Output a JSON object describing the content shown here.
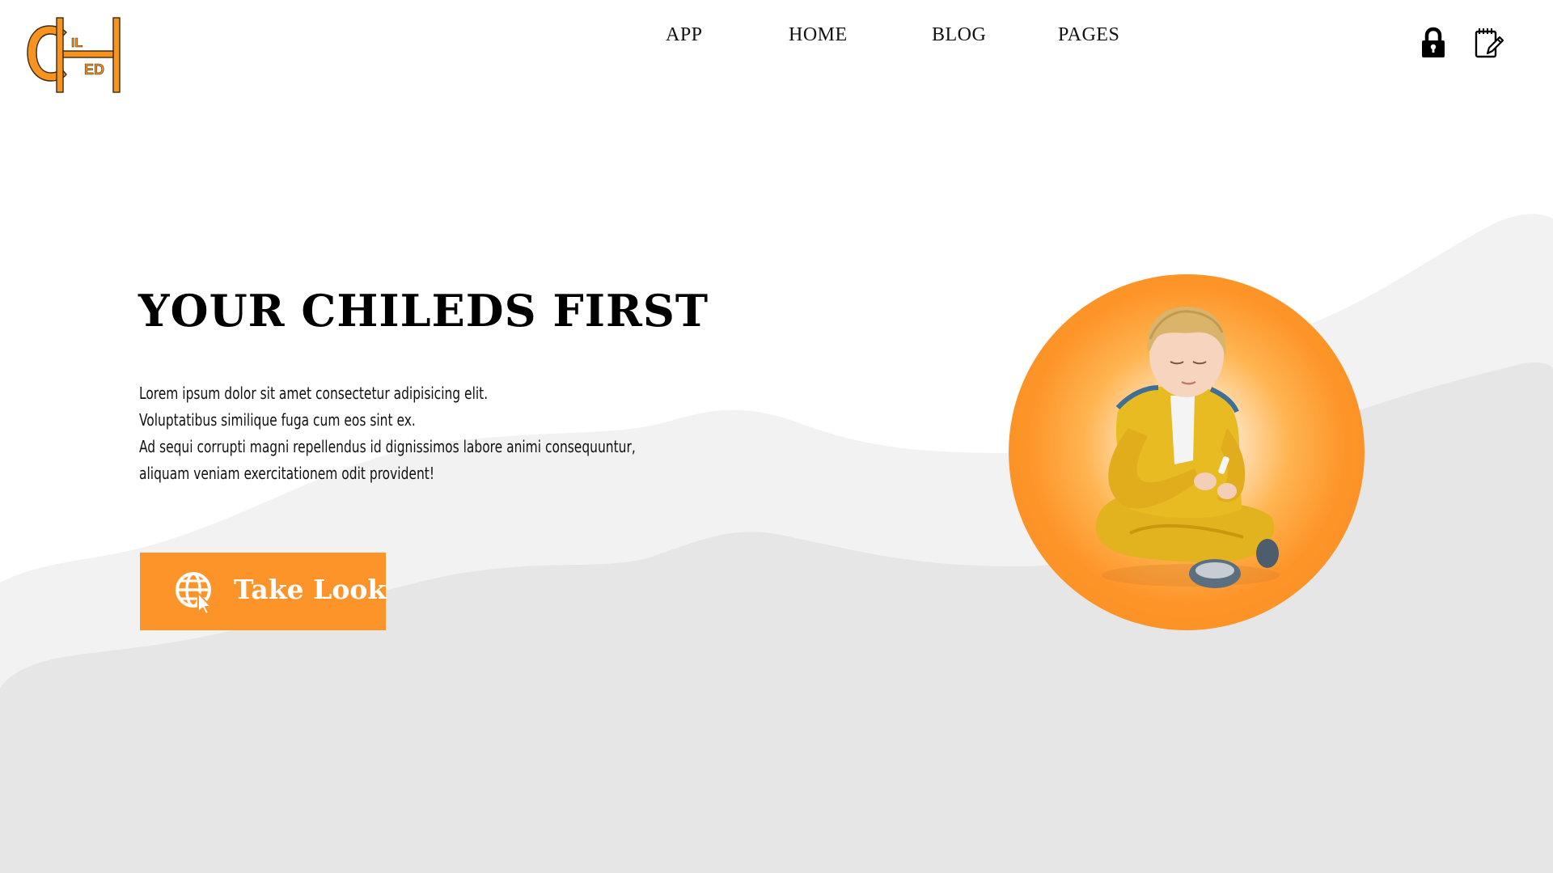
{
  "logo": {
    "letters_top": "IL",
    "letters_bottom": "ED",
    "colors": {
      "fill": "#f7931e",
      "stroke": "#3a2a10"
    }
  },
  "nav": {
    "items": [
      {
        "label": "APP"
      },
      {
        "label": "HOME"
      },
      {
        "label": "BLOG"
      },
      {
        "label": "PAGES"
      }
    ]
  },
  "header_icons": {
    "login_icon": "lock-icon",
    "register_icon": "notepad-edit-icon"
  },
  "hero": {
    "title": "YOUR CHILEDS FIRST",
    "paragraph_lines": [
      "Lorem ipsum dolor sit amet consectetur adipisicing elit.",
      "Voluptatibus similique fuga cum eos sint ex.",
      "Ad sequi corrupti magni repellendus id dignissimos labore animi consequuntur,",
      "aliquam veniam exercitationem odit provident!"
    ],
    "cta": {
      "label": "Take Look",
      "icon": "globe-cursor-icon"
    },
    "image": {
      "subject": "child-in-yellow-tracksuit"
    }
  },
  "colors": {
    "accent": "#fd9429",
    "wave_light": "#f2f2f2",
    "wave_dark": "#e6e6e6",
    "text": "#000000",
    "background": "#ffffff"
  }
}
